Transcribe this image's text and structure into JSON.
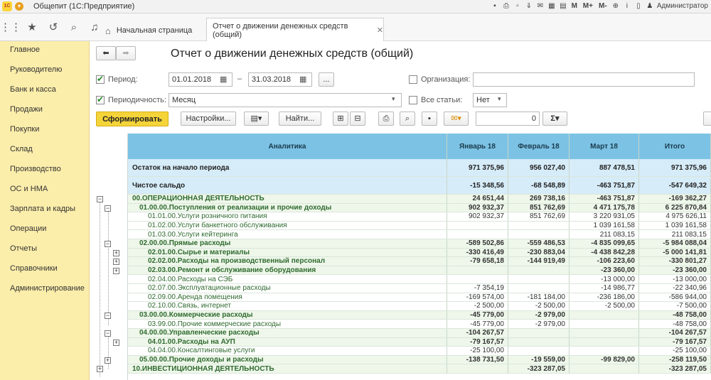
{
  "window": {
    "title": "Общепит (1С:Предприятие)",
    "user": "Администратор",
    "memory_buttons": [
      "M",
      "M+",
      "M-"
    ]
  },
  "tabs": {
    "home": "Начальная страница",
    "report": "Отчет о движении денежных средств (общий)"
  },
  "sidebar": {
    "items": [
      "Главное",
      "Руководителю",
      "Банк и касса",
      "Продажи",
      "Покупки",
      "Склад",
      "Производство",
      "ОС и НМА",
      "Зарплата и кадры",
      "Операции",
      "Отчеты",
      "Справочники",
      "Администрирование"
    ]
  },
  "form": {
    "title": "Отчет о движении денежных средств (общий)",
    "period_label": "Период:",
    "date_from": "01.01.2018",
    "date_sep": "–",
    "date_to": "31.03.2018",
    "ellipsis": "...",
    "org_label": "Организация:",
    "periodicity_label": "Периодичность:",
    "periodicity_value": "Месяц",
    "all_items_label": "Все статьи:",
    "all_items_value": "Нет",
    "generate": "Сформировать",
    "settings": "Настройки...",
    "find": "Найти...",
    "number_value": "0",
    "sum_symbol": "Σ"
  },
  "table": {
    "headers": [
      "Аналитика",
      "Январь 18",
      "Февраль 18",
      "Март 18",
      "Итого"
    ],
    "rows": [
      {
        "label": "Остаток на начало периода",
        "values": [
          "971 375,96",
          "956 027,40",
          "887 478,51",
          "971 375,96"
        ]
      },
      {
        "label": "Чистое сальдо",
        "values": [
          "-15 348,56",
          "-68 548,89",
          "-463 751,87",
          "-547 649,32"
        ]
      },
      {
        "label": "00.ОПЕРАЦИОННАЯ ДЕЯТЕЛЬНОСТЬ",
        "values": [
          "24 651,44",
          "269 738,16",
          "-463 751,87",
          "-169 362,27"
        ]
      },
      {
        "label": "01.00.00.Поступления от реализации и прочие доходы",
        "values": [
          "902 932,37",
          "851 762,69",
          "4 471 175,78",
          "6 225 870,84"
        ]
      },
      {
        "label": "01.01.00.Услуги розничного питания",
        "values": [
          "902 932,37",
          "851 762,69",
          "3 220 931,05",
          "4 975 626,11"
        ]
      },
      {
        "label": "01.02.00.Услуги банкетного обслуживания",
        "values": [
          "",
          "",
          "1 039 161,58",
          "1 039 161,58"
        ]
      },
      {
        "label": "01.03.00.Услуги кейтеринга",
        "values": [
          "",
          "",
          "211 083,15",
          "211 083,15"
        ]
      },
      {
        "label": "02.00.00.Прямые расходы",
        "values": [
          "-589 502,86",
          "-559 486,53",
          "-4 835 099,65",
          "-5 984 088,04"
        ]
      },
      {
        "label": "02.01.00.Сырье и материалы",
        "values": [
          "-330 416,49",
          "-230 883,04",
          "-4 438 842,28",
          "-5 000 141,81"
        ]
      },
      {
        "label": "02.02.00.Расходы на производственный персонал",
        "values": [
          "-79 658,18",
          "-144 919,49",
          "-106 223,60",
          "-330 801,27"
        ]
      },
      {
        "label": "02.03.00.Ремонт и обслуживание оборудования",
        "values": [
          "",
          "",
          "-23 360,00",
          "-23 360,00"
        ]
      },
      {
        "label": "02.04.00.Расходы на СЭБ",
        "values": [
          "",
          "",
          "-13 000,00",
          "-13 000,00"
        ]
      },
      {
        "label": "02.07.00.Эксплуатационные расходы",
        "values": [
          "-7 354,19",
          "",
          "-14 986,77",
          "-22 340,96"
        ]
      },
      {
        "label": "02.09.00.Аренда помещения",
        "values": [
          "-169 574,00",
          "-181 184,00",
          "-236 186,00",
          "-586 944,00"
        ]
      },
      {
        "label": "02.10.00.Связь, интернет",
        "values": [
          "-2 500,00",
          "-2 500,00",
          "-2 500,00",
          "-7 500,00"
        ]
      },
      {
        "label": "03.00.00.Коммерческие расходы",
        "values": [
          "-45 779,00",
          "-2 979,00",
          "",
          "-48 758,00"
        ]
      },
      {
        "label": "03.99.00.Прочие коммерческие расходы",
        "values": [
          "-45 779,00",
          "-2 979,00",
          "",
          "-48 758,00"
        ]
      },
      {
        "label": "04.00.00.Управленческие расходы",
        "values": [
          "-104 267,57",
          "",
          "",
          "-104 267,57"
        ]
      },
      {
        "label": "04.01.00.Расходы на АУП",
        "values": [
          "-79 167,57",
          "",
          "",
          "-79 167,57"
        ]
      },
      {
        "label": "04.04.00.Консалтинговые услуги",
        "values": [
          "-25 100,00",
          "",
          "",
          "-25 100,00"
        ]
      },
      {
        "label": "05.00.00.Прочие доходы и расходы",
        "values": [
          "-138 731,50",
          "-19 559,00",
          "-99 829,00",
          "-258 119,50"
        ]
      },
      {
        "label": "10.ИНВЕСТИЦИОННАЯ ДЕЯТЕЛЬНОСТЬ",
        "values": [
          "",
          "-323 287,05",
          "",
          "-323 287,05"
        ]
      }
    ]
  }
}
